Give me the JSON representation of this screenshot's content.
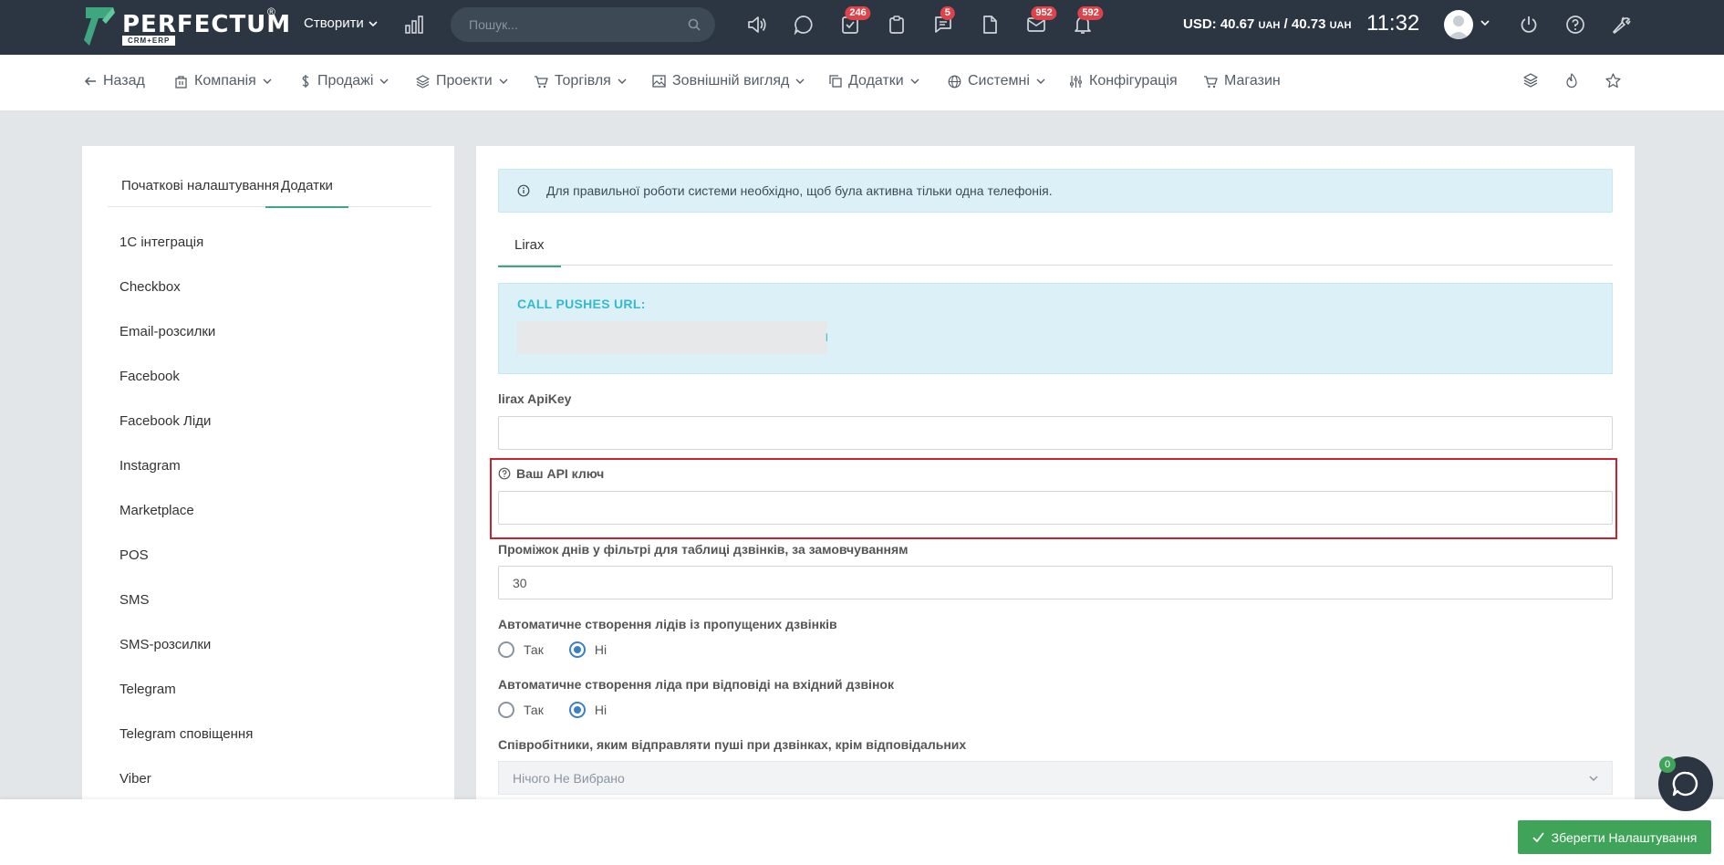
{
  "topbar": {
    "brand": "PERFECTUM",
    "brand_reg": "®",
    "brand_sub": "CRM+ERP",
    "create_label": "Створити",
    "search_placeholder": "Пошук...",
    "badges": {
      "tasks": "246",
      "messages": "5",
      "mail": "952",
      "notifications": "592"
    },
    "currency_usd": "USD: 40.67",
    "currency_unit1": "UAH",
    "currency_sep": " / 40.73 ",
    "currency_unit2": "UAH",
    "time": "11:32"
  },
  "nav": {
    "back": "Назад",
    "company": "Компанія",
    "sales": "Продажі",
    "projects": "Проекти",
    "trade": "Торгівля",
    "appearance": "Зовнішній вигляд",
    "addons": "Додатки",
    "system": "Системні",
    "config": "Конфігурація",
    "shop": "Магазин"
  },
  "left_panel": {
    "tabs": [
      "Початкові налаштування",
      "Додатки"
    ],
    "active_tab": "Додатки",
    "items": [
      "1С інтеграція",
      "Checkbox",
      "Email-розсилки",
      "Facebook",
      "Facebook Ліди",
      "Instagram",
      "Marketplace",
      "POS",
      "SMS",
      "SMS-розсилки",
      "Telegram",
      "Telegram сповіщення",
      "Viber"
    ]
  },
  "main": {
    "alert_text": "Для правильної роботи системи необхідно, щоб була активна тільки одна телефонія.",
    "tab": "Lirax",
    "call_pushes_label": "CALL PUSHES URL:",
    "call_pushes_tail": "l",
    "apikey_label": "lirax ApiKey",
    "apikey_value": "",
    "your_api_label": "Ваш API ключ",
    "your_api_value": "",
    "days_label": "Проміжок днів у фільтрі для таблиці дзвінків, за замовчуванням",
    "days_value": "30",
    "auto_missed_label": "Автоматичне створення лідів із пропущених дзвінків",
    "auto_answer_label": "Автоматичне створення ліда при відповіді на вхідний дзвінок",
    "yes": "Так",
    "no": "Ні",
    "auto_missed_selected": "Ні",
    "auto_answer_selected": "Ні",
    "employees_label": "Співробітники, яким відправляти пуші при дзвінках, крім відповідальних",
    "employees_placeholder": "Нічого Не Вибрано"
  },
  "bottom": {
    "save_label": "Зберегти Налаштування"
  },
  "chat": {
    "badge": "0"
  },
  "colors": {
    "topbar_bg": "#2b3642",
    "accent_green": "#3fa35a",
    "info_bg": "#dcf1f7",
    "info_label": "#36b9cc",
    "highlight_red": "#c8232c",
    "badge_red": "#e0424a",
    "radio_blue": "#3b7fc4"
  },
  "icons": [
    "logo-icon",
    "chevron-down-icon",
    "bar-chart-icon",
    "search-icon",
    "megaphone-icon",
    "chat-bubble-icon",
    "tasks-icon",
    "clipboard-icon",
    "messages-icon",
    "file-icon",
    "mail-icon",
    "bell-icon",
    "power-icon",
    "help-icon",
    "wrench-icon",
    "arrow-left-icon",
    "building-icon",
    "dollar-icon",
    "layers-icon",
    "cart-icon",
    "image-icon",
    "copy-icon",
    "globe-icon",
    "sliders-icon",
    "fire-icon",
    "star-icon",
    "info-icon",
    "question-icon",
    "check-icon"
  ]
}
